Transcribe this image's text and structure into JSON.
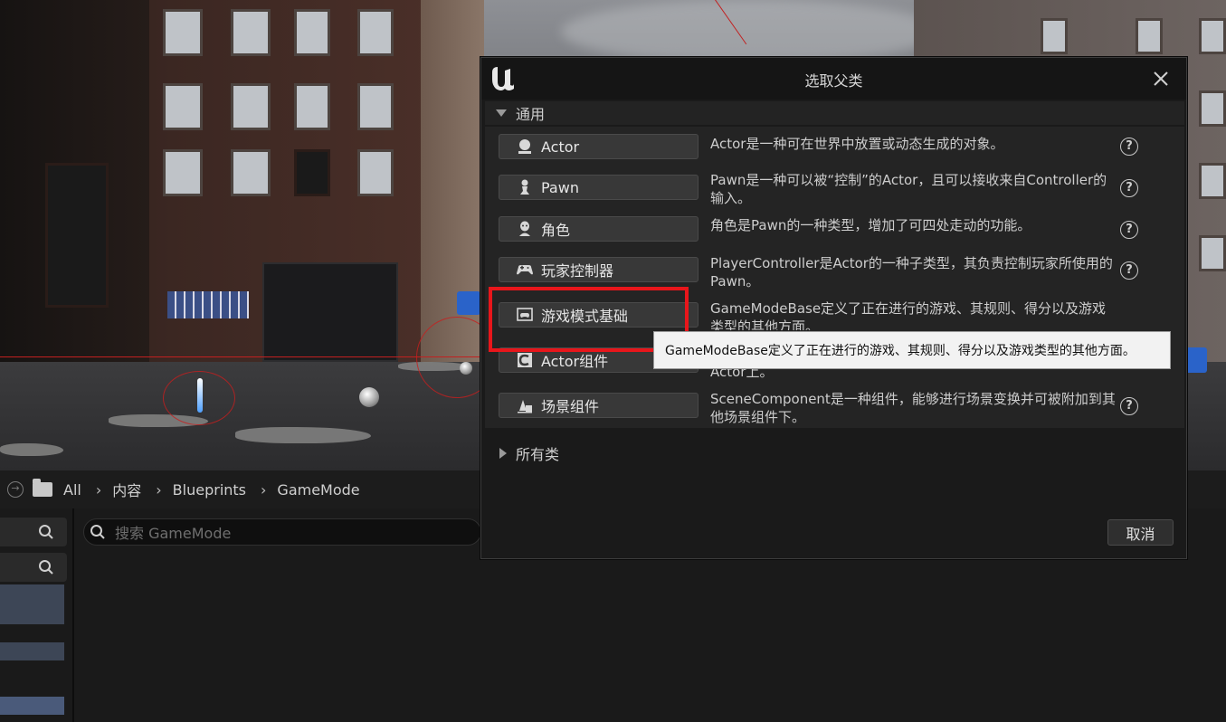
{
  "dialog": {
    "title": "选取父类",
    "close_icon": "close-icon",
    "common_section_label": "通用",
    "all_classes_label": "所有类",
    "cancel_label": "取消",
    "classes": [
      {
        "label": "Actor",
        "icon": "actor-icon",
        "description": "Actor是一种可在世界中放置或动态生成的对象。"
      },
      {
        "label": "Pawn",
        "icon": "pawn-icon",
        "description": "Pawn是一种可以被“控制”的Actor，且可以接收来自Controller的输入。"
      },
      {
        "label": "角色",
        "icon": "character-icon",
        "description": "角色是Pawn的一种类型，增加了可四处走动的功能。"
      },
      {
        "label": "玩家控制器",
        "icon": "gamepad-icon",
        "description": "PlayerController是Actor的一种子类型，其负责控制玩家所使用的Pawn。"
      },
      {
        "label": "游戏模式基础",
        "icon": "gamemode-icon",
        "description": "GameModeBase定义了正在进行的游戏、其规则、得分以及游戏类型的其他方面。"
      },
      {
        "label": "Actor组件",
        "icon": "component-icon",
        "description": "Actor上。"
      },
      {
        "label": "场景组件",
        "icon": "scene-component-icon",
        "description": "SceneComponent是一种组件，能够进行场景变换并可被附加到其他场景组件下。"
      }
    ]
  },
  "tooltip": {
    "text": "GameModeBase定义了正在进行的游戏、其规则、得分以及游戏类型的其他方面。"
  },
  "content_browser": {
    "breadcrumbs": [
      "All",
      "内容",
      "Blueprints",
      "GameMode"
    ],
    "search_placeholder": "搜索 GameMode"
  },
  "colors": {
    "highlight": "#e8161b",
    "dialog_bg": "#1a1a1a",
    "button_bg": "#383838"
  }
}
